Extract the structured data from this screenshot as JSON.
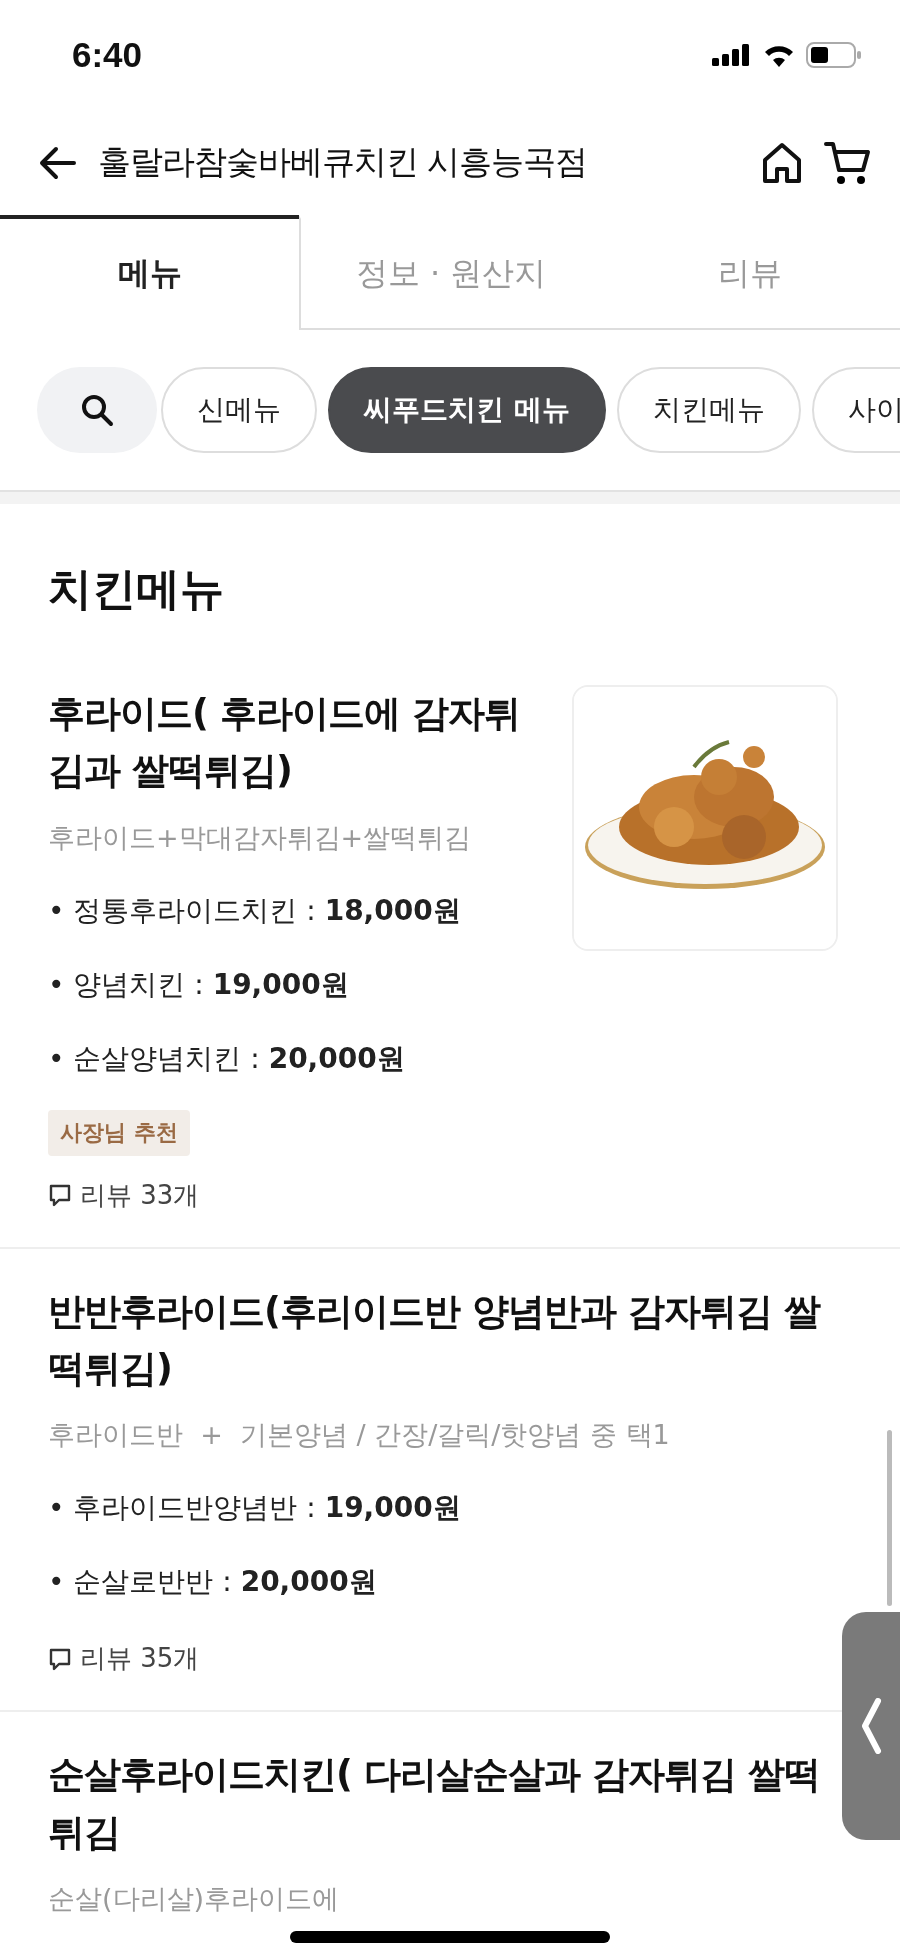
{
  "status_bar": {
    "time": "6:40"
  },
  "header": {
    "title": "훌랄라참숯바베큐치킨 시흥능곡점"
  },
  "tabs": [
    {
      "label": "메뉴",
      "selected": true
    },
    {
      "label": "정보 · 원산지",
      "selected": false
    },
    {
      "label": "리뷰",
      "selected": false
    }
  ],
  "chips": [
    {
      "label": "신메뉴",
      "selected": false
    },
    {
      "label": "씨푸드치킨 메뉴",
      "selected": true
    },
    {
      "label": "치킨메뉴",
      "selected": false
    },
    {
      "label": "사이",
      "selected": false
    }
  ],
  "section_title": "치킨메뉴",
  "menu_items": [
    {
      "title": "후라이드( 후라이드에 감자튀김과 쌀떡튀김)",
      "description": "후라이드+막대감자튀김+쌀떡튀김",
      "options": [
        "• 정통후라이드치킨 : **18,000원**",
        "• 양념치킨 : **19,000원**",
        "• 순살양념치킨 : **20,000원**"
      ],
      "badge": "사장님 추천",
      "reviews": "리뷰 33개",
      "image": {
        "kind": "picture"
      }
    },
    {
      "title": "반반후라이드(후리이드반 양념반과 감자튀김 쌀떡튀김)",
      "description": "후라이드반  +  기본양념 / 간장/갈릭/핫양념 중 택1",
      "options": [
        "• 후라이드반양념반 : **19,000원**",
        "• 순살로반반 : **20,000원**"
      ],
      "reviews": "리뷰 35개"
    },
    {
      "title": "순살후라이드치킨( 다리살순살과 감자튀김 쌀떡튀김",
      "description": "순살(다리살)후라이드에"
    }
  ]
}
